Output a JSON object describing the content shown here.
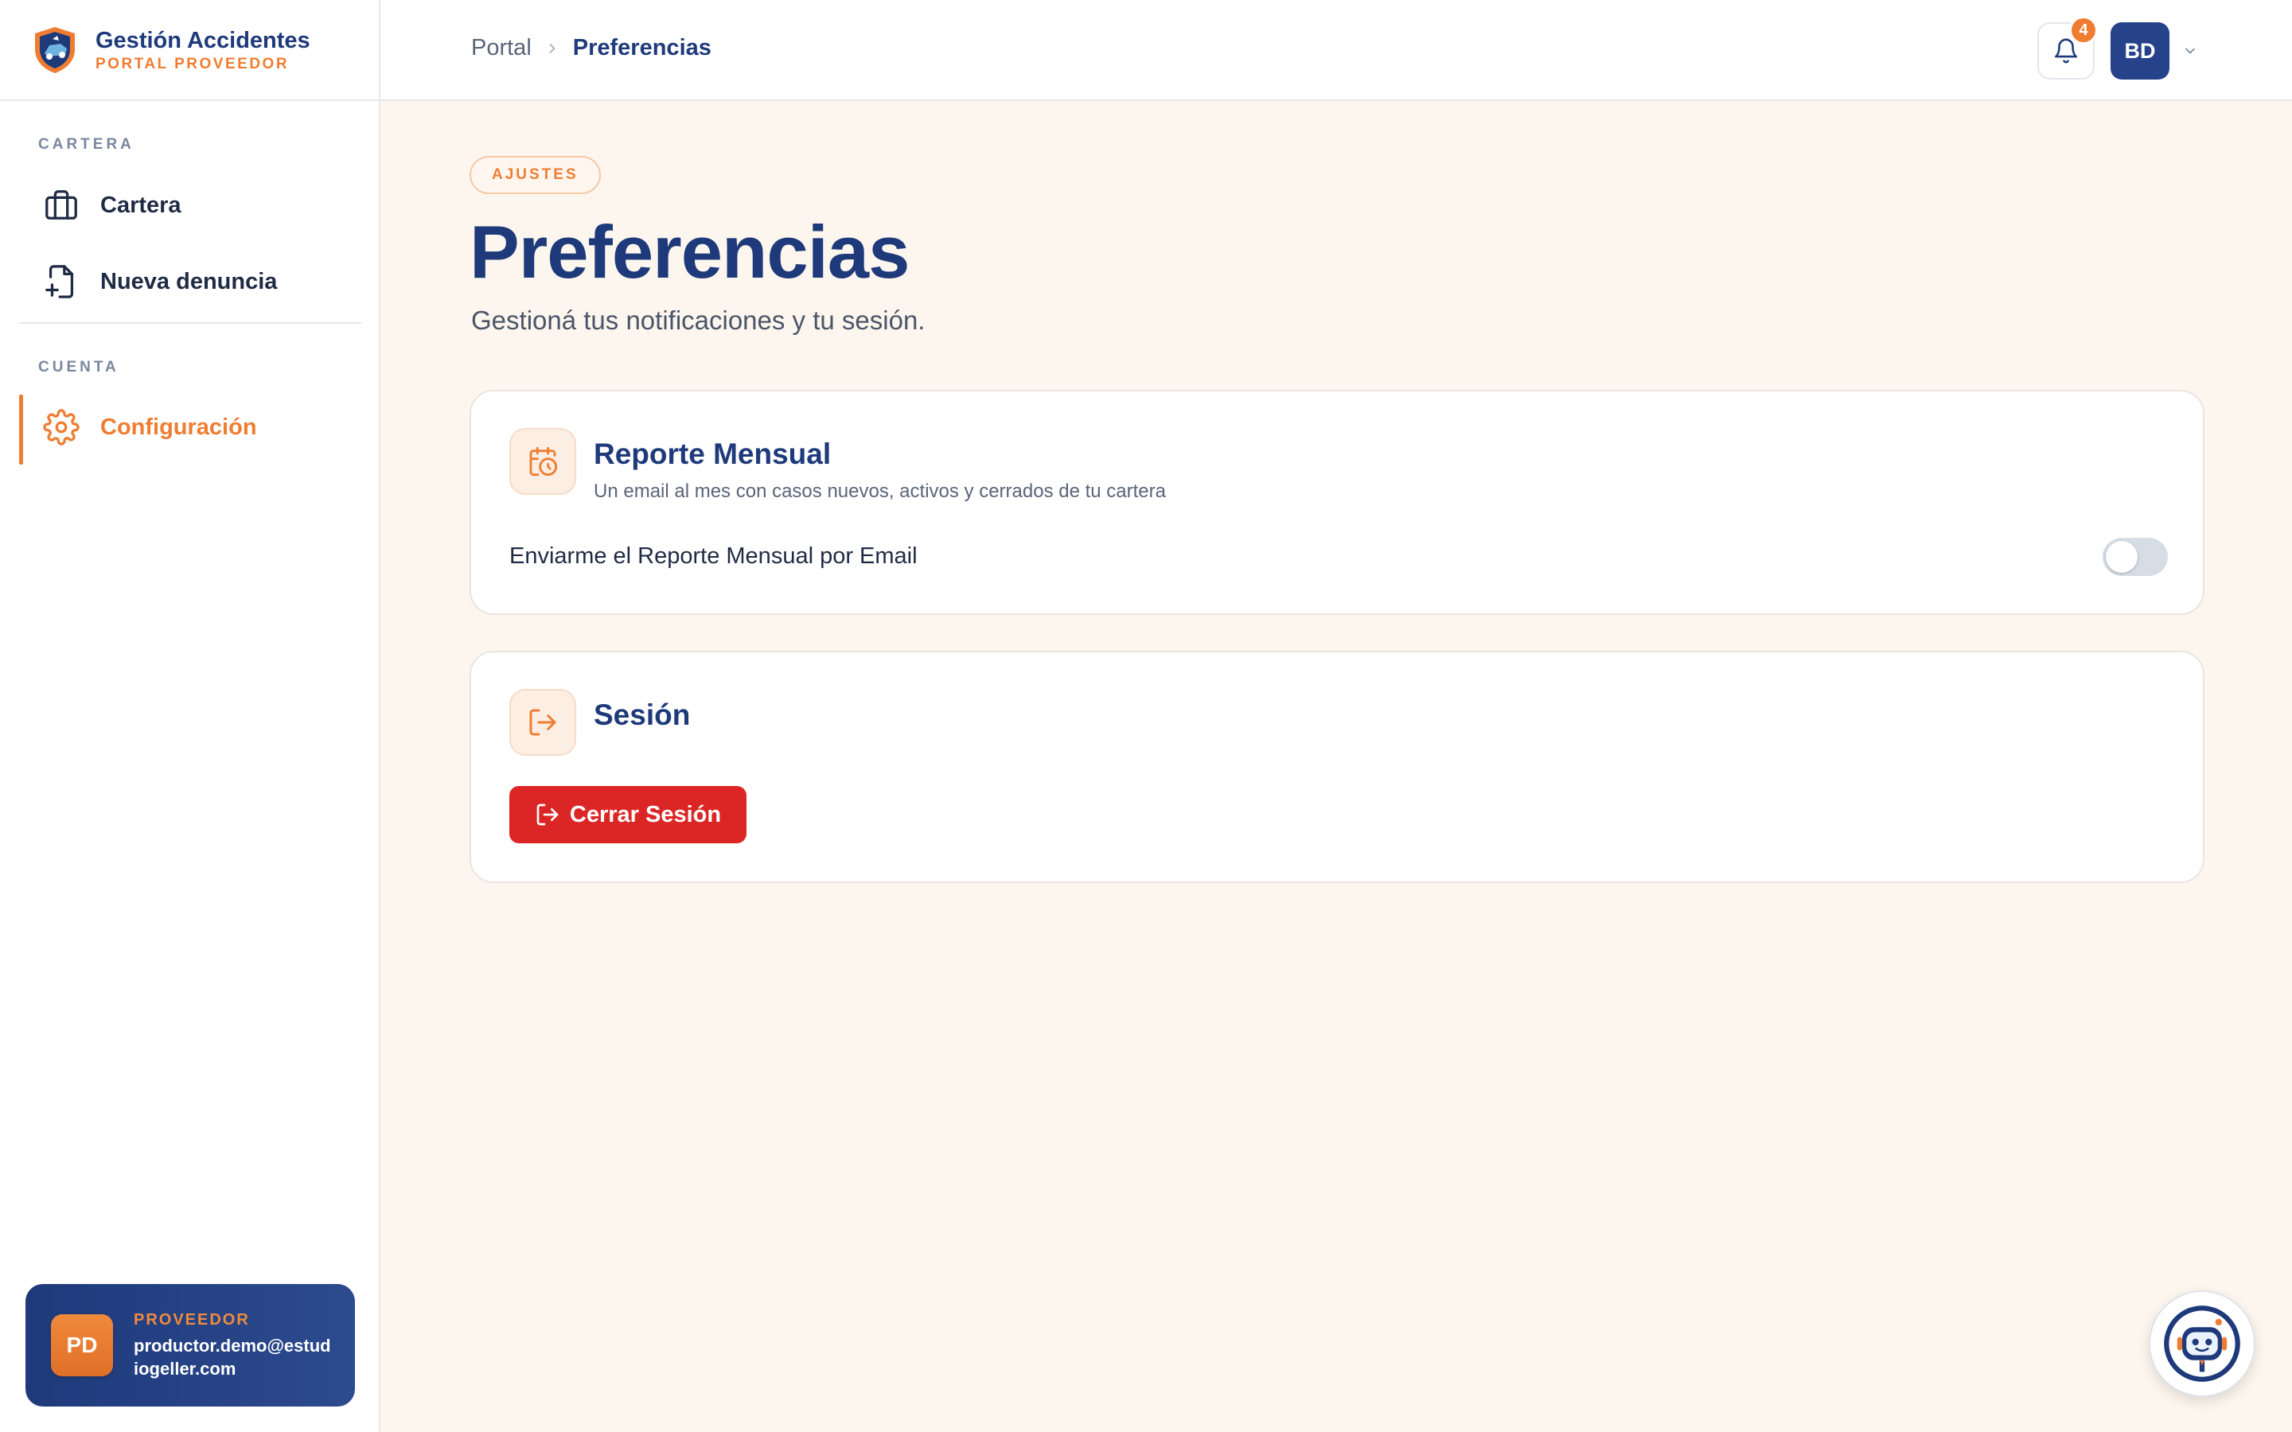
{
  "brand": {
    "title": "Gestión Accidentes",
    "subtitle": "PORTAL PROVEEDOR"
  },
  "sidebar": {
    "sections": [
      {
        "label": "CARTERA"
      },
      {
        "label": "CUENTA"
      }
    ],
    "items": [
      {
        "label": "Cartera",
        "icon": "briefcase-icon"
      },
      {
        "label": "Nueva denuncia",
        "icon": "file-plus-icon"
      },
      {
        "label": "Configuración",
        "icon": "gear-icon",
        "active": true
      }
    ]
  },
  "user": {
    "initials": "PD",
    "role": "PROVEEDOR",
    "email": "productor.demo@estudiogeller.com"
  },
  "topbar": {
    "breadcrumb": [
      "Portal",
      "Preferencias"
    ],
    "notifications_count": "4",
    "avatar_initials": "BD"
  },
  "main": {
    "tag": "AJUSTES",
    "title": "Preferencias",
    "subtitle": "Gestioná tus notificaciones y tu sesión.",
    "cards": {
      "report": {
        "title": "Reporte Mensual",
        "description": "Un email al mes con casos nuevos, activos y cerrados de tu cartera",
        "toggle_label": "Enviarme el Reporte Mensual por Email",
        "toggle_on": false,
        "icon": "calendar-clock-icon"
      },
      "session": {
        "title": "Sesión",
        "logout_label": "Cerrar Sesión",
        "icon": "logout-icon"
      }
    }
  },
  "colors": {
    "brand_blue": "#1e3a7b",
    "accent_orange": "#ef7d31",
    "danger_red": "#dc2626",
    "page_bg": "#fdf6ee"
  }
}
